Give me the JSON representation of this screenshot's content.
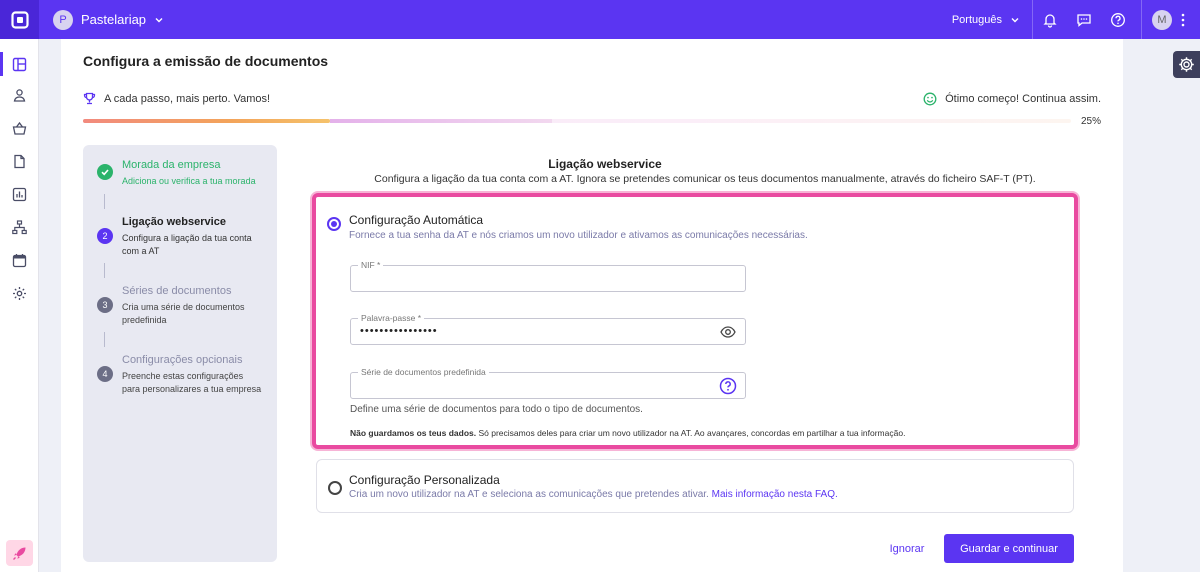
{
  "header": {
    "company_initial": "P",
    "company_name": "Pastelariap",
    "language": "Português",
    "user_initial": "M"
  },
  "page": {
    "title": "Configura a emissão de documentos"
  },
  "progress": {
    "left_text": "A cada passo, mais perto. Vamos!",
    "right_text": "Ótimo começo! Continua assim.",
    "percent_label": "25%",
    "value": 0.25
  },
  "steps": [
    {
      "num": "✓",
      "title": "Morada da empresa",
      "desc": "Adiciona ou verifica a tua morada",
      "state": "done"
    },
    {
      "num": "2",
      "title": "Ligação webservice",
      "desc": "Configura a ligação da tua conta com a AT",
      "state": "current"
    },
    {
      "num": "3",
      "title": "Séries de documentos",
      "desc": "Cria uma série de documentos predefinida",
      "state": "pending"
    },
    {
      "num": "4",
      "title": "Configurações opcionais",
      "desc": "Preenche estas configurações para personalizares a tua empresa",
      "state": "pending"
    }
  ],
  "section": {
    "title": "Ligação webservice",
    "subtitle": "Configura a ligação da tua conta com a AT. Ignora se pretendes comunicar os teus documentos manualmente, através do ficheiro SAF-T (PT)."
  },
  "auto": {
    "title": "Configuração Automática",
    "desc": "Fornece a tua senha da AT e nós criamos um novo utilizador e ativamos as comunicações necessárias.",
    "nif_label": "NIF *",
    "nif_value": "",
    "password_label": "Palavra-passe *",
    "password_value": "••••••••••••••••",
    "series_label": "Série de documentos predefinida",
    "series_value": "",
    "hint": "Define uma série de documentos para todo o tipo de documentos.",
    "notice_bold": "Não guardamos os teus dados.",
    "notice_rest": " Só precisamos deles para criar um novo utilizador na AT. Ao avançares, concordas em partilhar a tua informação."
  },
  "custom": {
    "title": "Configuração Personalizada",
    "desc": "Cria um novo utilizador na AT e seleciona as comunicações que pretendes ativar. ",
    "link": "Mais informação nesta FAQ."
  },
  "actions": {
    "ignore": "Ignorar",
    "save": "Guardar e continuar"
  },
  "colors": {
    "brand": "#5b35f2",
    "highlight": "#e94aa0",
    "done": "#2bb36b"
  }
}
